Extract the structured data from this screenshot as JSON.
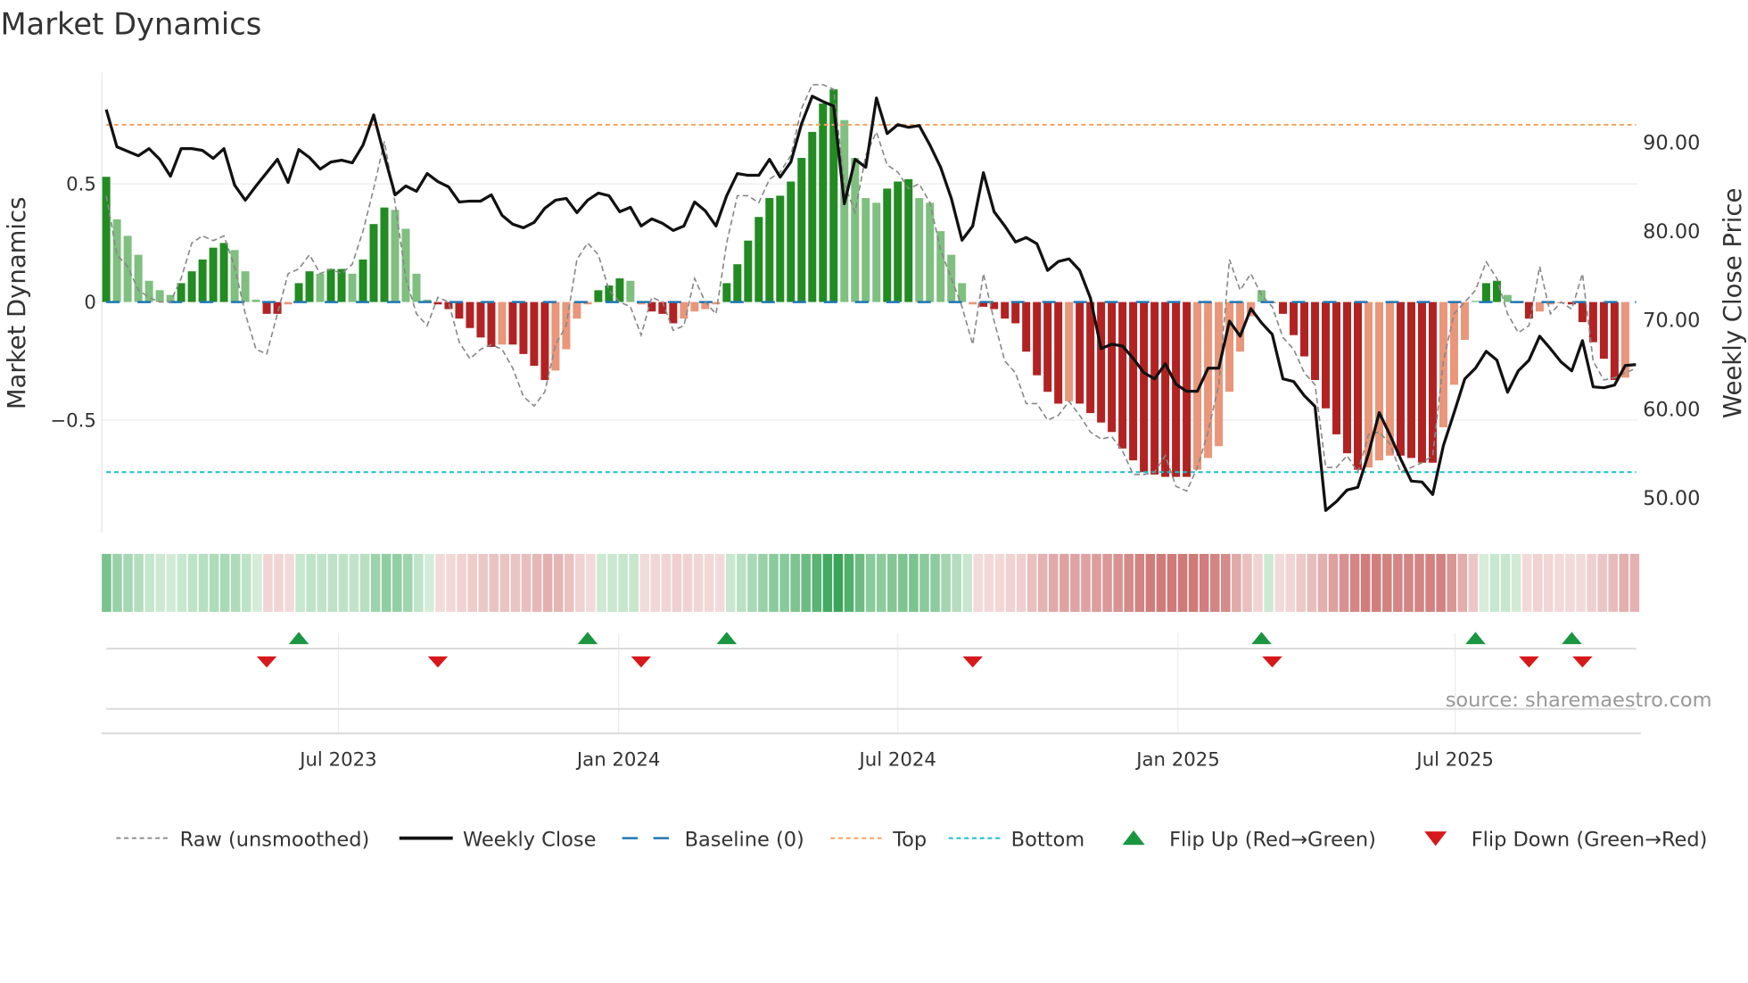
{
  "chart_data": {
    "type": "bar",
    "title": "Market Dynamics",
    "ylabel_left": "Market Dynamics",
    "ylabel_right": "Weekly Close Price",
    "source": "source: sharemaestro.com",
    "x_unit": "week index",
    "ylim_left": [
      -0.98,
      0.98
    ],
    "ylim_right": [
      46.5,
      99.0
    ],
    "left_ticks": [
      {
        "v": 0.5,
        "label": "0.5"
      },
      {
        "v": 0,
        "label": "0"
      },
      {
        "v": -0.5,
        "label": "−0.5"
      }
    ],
    "right_ticks": [
      {
        "v": 90,
        "label": "90.00"
      },
      {
        "v": 80,
        "label": "80.00"
      },
      {
        "v": 70,
        "label": "70.00"
      },
      {
        "v": 60,
        "label": "60.00"
      },
      {
        "v": 50,
        "label": "50.00"
      }
    ],
    "x_ticks": [
      {
        "w": 21.7,
        "label": "Jul 2023"
      },
      {
        "w": 47.9,
        "label": "Jan 2024"
      },
      {
        "w": 74.0,
        "label": "Jul 2024"
      },
      {
        "w": 100.2,
        "label": "Jan 2025"
      },
      {
        "w": 126.1,
        "label": "Jul 2025"
      }
    ],
    "top_level": 0.75,
    "bottom_level": -0.72,
    "baseline": 0,
    "dynamics": [
      0.53,
      0.35,
      0.28,
      0.2,
      0.09,
      0.05,
      0.03,
      0.08,
      0.13,
      0.18,
      0.23,
      0.25,
      0.22,
      0.13,
      0.01,
      -0.05,
      -0.05,
      -0.01,
      0.08,
      0.13,
      0.12,
      0.14,
      0.14,
      0.12,
      0.18,
      0.33,
      0.4,
      0.39,
      0.31,
      0.12,
      0.01,
      -0.01,
      -0.03,
      -0.07,
      -0.11,
      -0.15,
      -0.19,
      -0.18,
      -0.18,
      -0.22,
      -0.27,
      -0.33,
      -0.29,
      -0.2,
      -0.07,
      -0.01,
      0.05,
      0.07,
      0.1,
      0.09,
      -0.01,
      -0.04,
      -0.05,
      -0.09,
      -0.07,
      -0.04,
      -0.03,
      -0.01,
      0.08,
      0.16,
      0.26,
      0.36,
      0.44,
      0.45,
      0.51,
      0.61,
      0.72,
      0.84,
      0.9,
      0.77,
      0.61,
      0.44,
      0.42,
      0.48,
      0.51,
      0.52,
      0.44,
      0.42,
      0.3,
      0.2,
      0.08,
      -0.01,
      -0.02,
      -0.03,
      -0.07,
      -0.09,
      -0.21,
      -0.31,
      -0.38,
      -0.43,
      -0.42,
      -0.43,
      -0.47,
      -0.51,
      -0.55,
      -0.62,
      -0.67,
      -0.72,
      -0.73,
      -0.74,
      -0.74,
      -0.74,
      -0.71,
      -0.66,
      -0.61,
      -0.38,
      -0.21,
      -0.06,
      0.05,
      -0.005,
      -0.05,
      -0.14,
      -0.23,
      -0.33,
      -0.45,
      -0.56,
      -0.64,
      -0.71,
      -0.7,
      -0.67,
      -0.65,
      -0.65,
      -0.66,
      -0.68,
      -0.68,
      -0.53,
      -0.35,
      -0.16,
      0.005,
      0.08,
      0.09,
      0.03,
      -0.005,
      -0.07,
      -0.04,
      -0.01,
      -0.005,
      -0.01,
      -0.085,
      -0.17,
      -0.24,
      -0.33,
      -0.32
    ],
    "raw": [
      0.45,
      0.2,
      0.15,
      0.05,
      0.02,
      0.0,
      0.0,
      0.1,
      0.25,
      0.28,
      0.26,
      0.28,
      0.15,
      -0.05,
      -0.2,
      -0.22,
      -0.05,
      0.12,
      0.14,
      0.2,
      0.12,
      0.14,
      0.12,
      0.16,
      0.3,
      0.48,
      0.68,
      0.42,
      0.1,
      -0.05,
      -0.1,
      0.02,
      0.0,
      -0.17,
      -0.24,
      -0.2,
      -0.18,
      -0.2,
      -0.28,
      -0.4,
      -0.44,
      -0.38,
      -0.18,
      -0.1,
      0.18,
      0.25,
      0.2,
      0.05,
      0.0,
      -0.02,
      -0.14,
      0.02,
      0.0,
      -0.12,
      -0.1,
      0.1,
      0.0,
      -0.05,
      0.25,
      0.45,
      0.45,
      0.42,
      0.52,
      0.55,
      0.62,
      0.82,
      0.92,
      0.92,
      0.9,
      0.5,
      0.38,
      0.62,
      0.72,
      0.58,
      0.55,
      0.48,
      0.5,
      0.42,
      0.22,
      0.1,
      -0.02,
      -0.18,
      0.12,
      -0.08,
      -0.25,
      -0.3,
      -0.43,
      -0.43,
      -0.5,
      -0.48,
      -0.42,
      -0.48,
      -0.55,
      -0.58,
      -0.57,
      -0.63,
      -0.73,
      -0.73,
      -0.72,
      -0.65,
      -0.78,
      -0.8,
      -0.7,
      -0.55,
      -0.35,
      0.18,
      0.05,
      0.12,
      0.03,
      -0.02,
      -0.15,
      -0.2,
      -0.3,
      -0.35,
      -0.7,
      -0.7,
      -0.65,
      -0.72,
      -0.56,
      -0.55,
      -0.6,
      -0.72,
      -0.7,
      -0.68,
      -0.65,
      -0.25,
      -0.05,
      0.0,
      0.05,
      0.17,
      0.1,
      -0.05,
      -0.13,
      -0.1,
      0.15,
      -0.05,
      0.0,
      -0.03,
      0.12,
      -0.25,
      -0.33,
      -0.32,
      -0.3,
      -0.28
    ],
    "weekly_close": [
      93.6,
      89.4,
      88.9,
      88.4,
      89.2,
      88.0,
      86.1,
      89.2,
      89.2,
      89.0,
      88.1,
      89.2,
      85.1,
      83.4,
      85.0,
      86.5,
      88.0,
      85.4,
      89.1,
      88.2,
      86.9,
      87.7,
      87.9,
      87.6,
      89.6,
      93.0,
      88.4,
      84.0,
      85.0,
      84.4,
      86.4,
      85.5,
      84.9,
      83.2,
      83.3,
      83.3,
      84.0,
      81.7,
      80.7,
      80.3,
      80.9,
      82.5,
      83.4,
      83.6,
      82.0,
      83.4,
      84.2,
      83.9,
      82.1,
      82.6,
      80.5,
      81.3,
      80.8,
      80.0,
      80.5,
      83.2,
      82.2,
      80.5,
      83.9,
      86.4,
      86.2,
      86.2,
      88.0,
      86.0,
      87.7,
      92.0,
      95.1,
      94.5,
      94.0,
      83.0,
      88.0,
      87.1,
      94.9,
      90.9,
      91.9,
      91.6,
      91.8,
      89.6,
      87.1,
      83.6,
      78.9,
      80.5,
      86.5,
      82.1,
      80.5,
      78.7,
      79.2,
      78.5,
      75.5,
      76.5,
      76.8,
      75.5,
      72.4,
      66.7,
      67.2,
      67.0,
      65.6,
      64.0,
      63.3,
      65.0,
      62.7,
      61.9,
      61.9,
      64.5,
      64.5,
      69.8,
      68.1,
      71.2,
      69.6,
      68.3,
      63.3,
      63.0,
      61.4,
      60.2,
      48.5,
      49.5,
      50.8,
      51.1,
      54.9,
      59.5,
      57.0,
      54.3,
      51.8,
      51.7,
      50.3,
      55.8,
      59.5,
      63.3,
      64.5,
      66.4,
      65.4,
      61.8,
      64.2,
      65.4,
      68.1,
      66.7,
      65.2,
      64.2,
      67.6,
      62.4,
      62.3,
      62.6,
      64.8,
      64.9
    ],
    "flip_up_weeks": [
      18,
      45,
      58,
      108,
      128,
      137
    ],
    "flip_down_weeks": [
      15,
      31,
      50,
      81,
      109,
      133,
      138
    ],
    "legend_position": "bottom",
    "legend": [
      {
        "key": "raw",
        "label": "Raw (unsmoothed)"
      },
      {
        "key": "close",
        "label": "Weekly Close"
      },
      {
        "key": "baseline",
        "label": "Baseline (0)"
      },
      {
        "key": "top",
        "label": "Top"
      },
      {
        "key": "bottom",
        "label": "Bottom"
      },
      {
        "key": "flipup",
        "label": "Flip Up (Red→Green)"
      },
      {
        "key": "flipdown",
        "label": "Flip Down (Green→Red)"
      }
    ],
    "colors": {
      "green_strong": "#228b22",
      "green_weak": "#7fbf7f",
      "red_strong": "#b22222",
      "red_weak": "#e9967a",
      "close": "#111111",
      "raw": "#888888",
      "baseline": "#1f77b4",
      "top": "#f4a460",
      "bottom": "#17becf",
      "flip_up": "#1a9641",
      "flip_down": "#d7191c"
    }
  }
}
